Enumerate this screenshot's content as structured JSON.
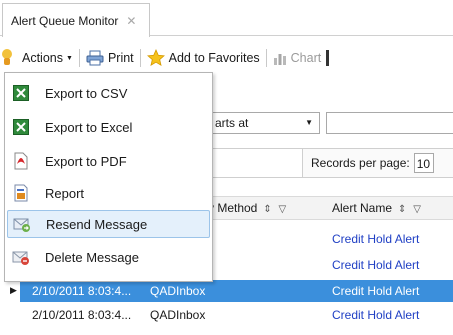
{
  "tab": {
    "title": "Alert Queue Monitor",
    "close_glyph": "✕"
  },
  "toolbar": {
    "actions_label": "Actions",
    "print_label": "Print",
    "favorites_label": "Add to Favorites",
    "chart_label": "Chart"
  },
  "filter": {
    "operator": "arts at"
  },
  "paging": {
    "label": "Records per page:",
    "value": "10"
  },
  "grid": {
    "columns": {
      "method": "y Method",
      "alert_name": "Alert Name"
    },
    "rows": [
      {
        "date": "",
        "method": "",
        "alert": "Credit Hold Alert"
      },
      {
        "date": "",
        "method": "",
        "alert": "Credit Hold Alert"
      },
      {
        "date": "2/10/2011 8:03:4...",
        "method": "QADInbox",
        "alert": "Credit Hold Alert"
      },
      {
        "date": "2/10/2011 8:03:4...",
        "method": "QADInbox",
        "alert": "Credit Hold Alert"
      }
    ]
  },
  "menu": {
    "items": [
      {
        "label": "Export to CSV",
        "icon": "excel-csv-icon"
      },
      {
        "label": "Export to Excel",
        "icon": "excel-icon"
      },
      {
        "label": "Export to PDF",
        "icon": "pdf-icon"
      },
      {
        "label": "Report",
        "icon": "report-icon"
      },
      {
        "label": "Resend Message",
        "icon": "resend-message-icon"
      },
      {
        "label": "Delete Message",
        "icon": "delete-message-icon"
      }
    ],
    "highlighted": "Resend Message"
  },
  "colors": {
    "selection": "#3b8fdc",
    "link": "#1f3fc4",
    "menu_hover": "#e4f0fb"
  }
}
